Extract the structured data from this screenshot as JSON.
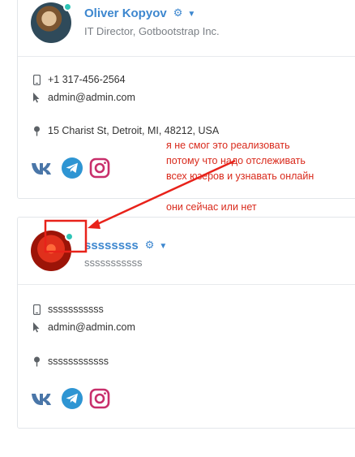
{
  "users": [
    {
      "name": "Oliver Kopyov",
      "title": "IT Director, Gotbootstrap Inc.",
      "phone": "+1 317-456-2564",
      "email": "admin@admin.com",
      "address": "15 Charist St, Detroit, MI, 48212, USA"
    },
    {
      "name": "ssssssss",
      "title": "sssssssssss",
      "phone": "sssssssssss",
      "email": "admin@admin.com",
      "address": "ssssssssssss"
    }
  ],
  "icons": {
    "settings": "gear-icon",
    "dropdown": "chevron-down-icon",
    "phone": "mobile-phone-icon",
    "email": "cursor-icon",
    "address": "map-pin-icon",
    "social": [
      "vk-icon",
      "telegram-icon",
      "instagram-icon"
    ]
  },
  "annotation": {
    "lines": [
      "я не смог это реализовать",
      "потому что надо отслеживать",
      "всех юзеров и узнавать онлайн",
      "они сейчас или нет"
    ]
  },
  "colors": {
    "name": "#3d87cf",
    "online": "#2ec4b6",
    "annotation": "#d92a1c",
    "vk": "#4a76a8",
    "telegram": "#2e95d3",
    "instagram": "#c82f6b"
  }
}
